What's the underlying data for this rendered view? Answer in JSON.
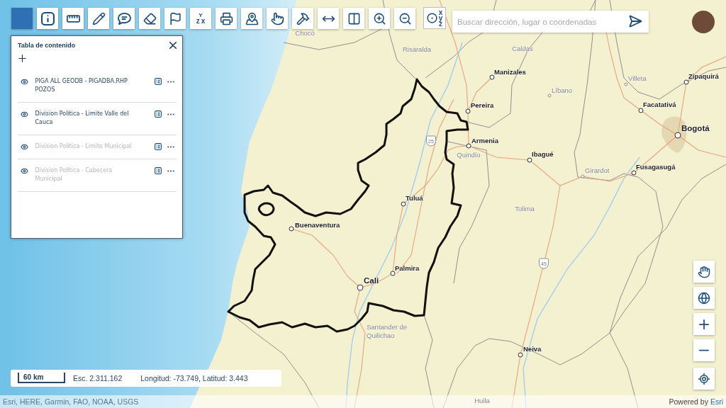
{
  "toolbar": {
    "tools": [
      {
        "kind": "blank",
        "selected": true
      },
      {
        "kind": "info",
        "selected": false
      },
      {
        "kind": "measure",
        "selected": false
      },
      {
        "kind": "draw",
        "selected": false
      },
      {
        "kind": "comment",
        "selected": false
      },
      {
        "kind": "erase",
        "selected": false
      },
      {
        "kind": "flag",
        "selected": false
      },
      {
        "kind": "sort",
        "selected": false,
        "letters": [
          "z",
          "Y",
          "x"
        ]
      },
      {
        "kind": "print",
        "selected": false
      },
      {
        "kind": "map_pin",
        "selected": false
      },
      {
        "kind": "pointer",
        "selected": false
      },
      {
        "kind": "hammer",
        "selected": false
      },
      {
        "kind": "swipe",
        "selected": false
      },
      {
        "kind": "split",
        "selected": false
      },
      {
        "kind": "zoom_in",
        "selected": false
      },
      {
        "kind": "zoom_out",
        "selected": false
      },
      {
        "kind": "coordinates",
        "selected": false,
        "letters": [
          "x",
          "y",
          "z"
        ]
      }
    ]
  },
  "search": {
    "placeholder": "Buscar dirección, lugar o coordenadas"
  },
  "table_of_contents": {
    "title": "Tabla de contenido",
    "layers": [
      {
        "name": "PIGA ALL GEODB - PIGADBA.RHP POZOS",
        "visible": true,
        "disabled": false
      },
      {
        "name": "Division Politica - Limite Valle del Cauca",
        "visible": true,
        "disabled": false
      },
      {
        "name": "Division Politica - Limite Municipal",
        "visible": true,
        "disabled": true
      },
      {
        "name": "Division Politica - Cabecera Municipal",
        "visible": true,
        "disabled": true
      }
    ]
  },
  "map": {
    "labels": [
      {
        "kind": "region",
        "text": "Chocó"
      },
      {
        "kind": "region",
        "text": "Risaralda"
      },
      {
        "kind": "region",
        "text": "Caldas"
      },
      {
        "kind": "city",
        "text": "Manizales"
      },
      {
        "kind": "town",
        "text": "Villeta"
      },
      {
        "kind": "city",
        "text": "Zipaquirá"
      },
      {
        "kind": "town",
        "text": "Líbano"
      },
      {
        "kind": "city",
        "text": "Pereira"
      },
      {
        "kind": "city",
        "text": "Facatativá"
      },
      {
        "kind": "major_city",
        "text": "Bogotá"
      },
      {
        "kind": "city",
        "text": "Armenia"
      },
      {
        "kind": "region",
        "text": "Quindío"
      },
      {
        "kind": "city",
        "text": "Ibagué"
      },
      {
        "kind": "town",
        "text": "Girardot"
      },
      {
        "kind": "city",
        "text": "Fusagasugá"
      },
      {
        "kind": "shield",
        "text": "25"
      },
      {
        "kind": "city",
        "text": "Tuluá"
      },
      {
        "kind": "region",
        "text": "Tolima"
      },
      {
        "kind": "city",
        "text": "Buenaventura"
      },
      {
        "kind": "city",
        "text": "Palmira"
      },
      {
        "kind": "major_city",
        "text": "Cali"
      },
      {
        "kind": "shield",
        "text": "45"
      },
      {
        "kind": "region",
        "text": "Santander de Quilichao"
      },
      {
        "kind": "city",
        "text": "Neiva"
      },
      {
        "kind": "region",
        "text": "Huila"
      }
    ]
  },
  "map_controls": [
    {
      "kind": "pan"
    },
    {
      "kind": "basemap"
    },
    {
      "kind": "zoom_in"
    },
    {
      "kind": "zoom_out"
    },
    {
      "kind": "locate"
    }
  ],
  "status": {
    "scale_bar": "60 km",
    "scale": "Esc. 2.311.162",
    "coordinates": "Longitud: -73.749, Latitud: 3.443"
  },
  "attribution": {
    "sources": "Esri, HERE, Garmin, FAO, NOAA, USGS",
    "powered_by": "Powered by",
    "link": "Esri"
  }
}
